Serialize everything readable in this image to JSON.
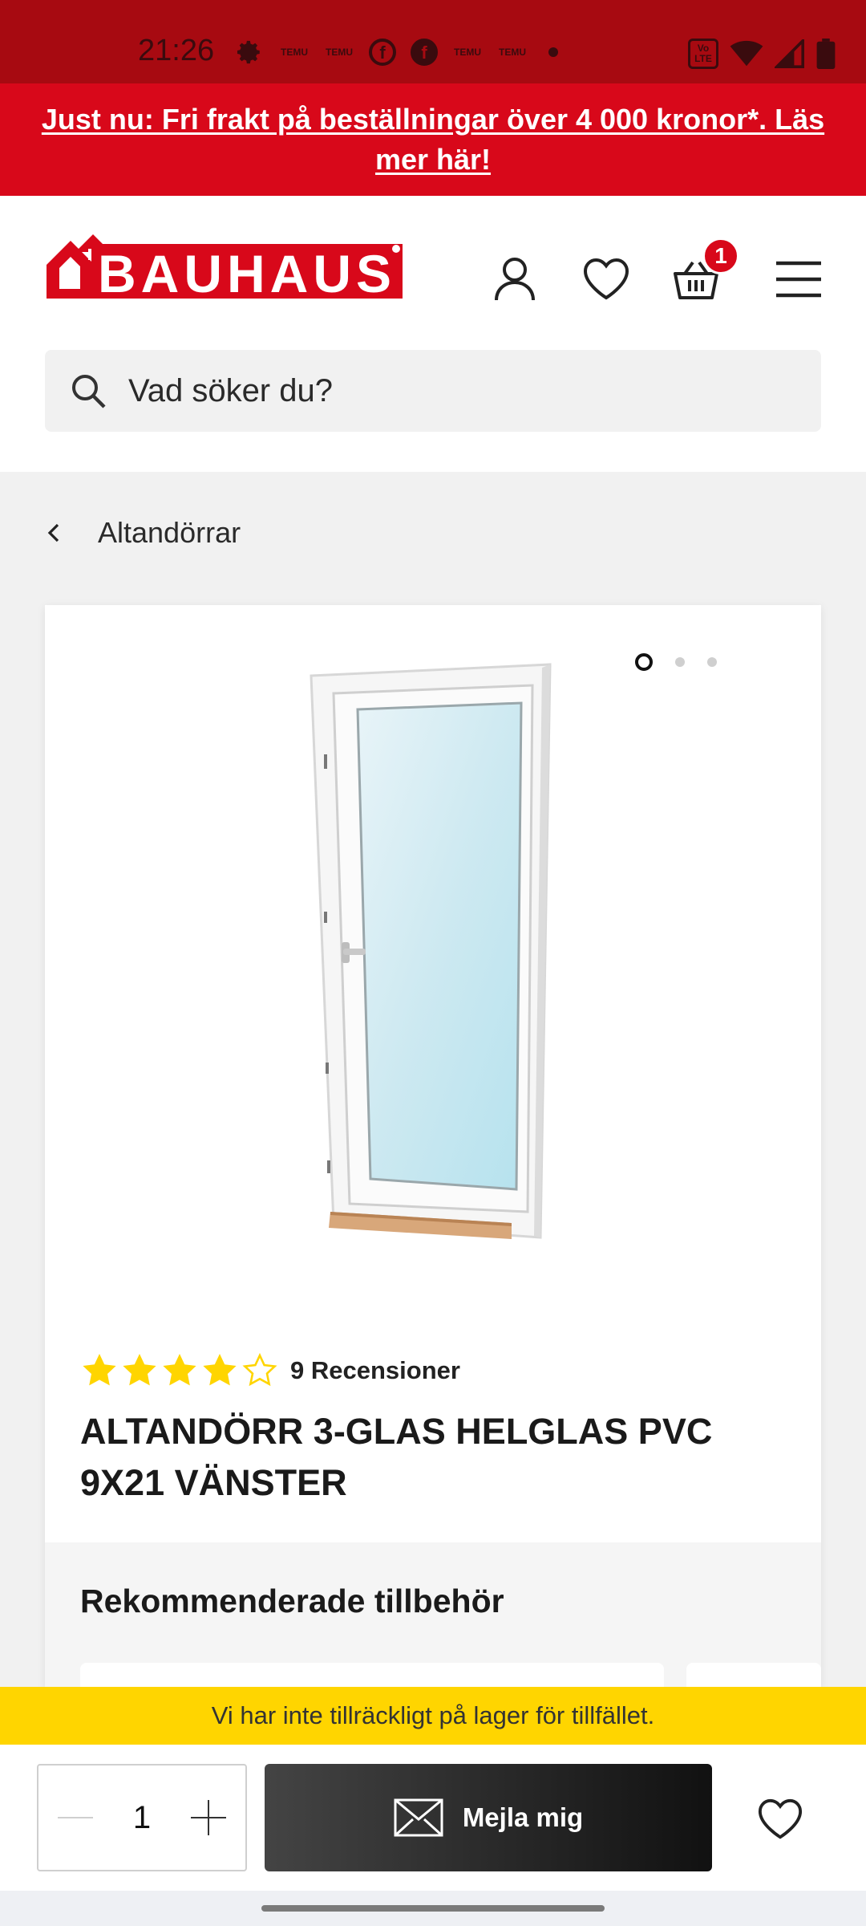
{
  "status_bar": {
    "time": "21:26",
    "left_icons": [
      "settings-icon",
      "temu-icon",
      "temu-icon",
      "facebook-icon",
      "facebook-icon",
      "temu-icon",
      "temu-icon",
      "dot-icon"
    ],
    "temu_label": "TEMU",
    "facebook_glyph": "f",
    "volte_label": "Vo LTE",
    "right_icons": [
      "volte-icon",
      "wifi-icon",
      "signal-icon",
      "battery-icon"
    ]
  },
  "promo": {
    "text": "Just nu: Fri frakt på beställningar över 4 000 kronor*. Läs mer här!",
    "bg_color": "#d8081a"
  },
  "header": {
    "brand": "BAUHAUS",
    "icons": [
      "account-icon",
      "wishlist-heart-icon",
      "cart-basket-icon",
      "hamburger-menu-icon"
    ],
    "cart_count": "1"
  },
  "search": {
    "placeholder": "Vad söker du?"
  },
  "breadcrumb": {
    "label": "Altandörrar"
  },
  "product": {
    "image_count": 3,
    "active_image": 1,
    "rating": 4,
    "rating_max": 5,
    "reviews_text": "9 Recensioner",
    "title": "ALTANDÖRR 3-GLAS HELGLAS PVC 9X21 VÄNSTER",
    "star_color": "#ffd500"
  },
  "accessories": {
    "title": "Rekommenderade tillbehör"
  },
  "stock": {
    "message": "Vi har inte tillräckligt på lager för tillfället.",
    "bg_color": "#ffd500"
  },
  "bottom_bar": {
    "quantity": "1",
    "mail_button": "Mejla mig"
  }
}
